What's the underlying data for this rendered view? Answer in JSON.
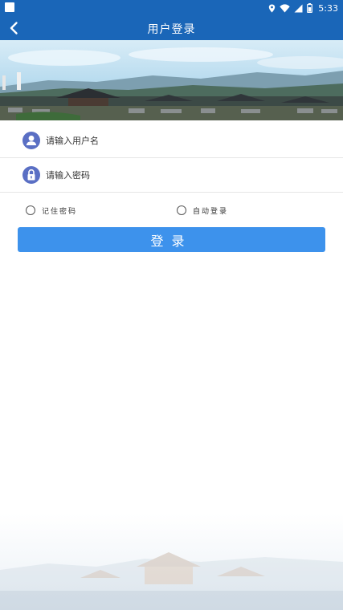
{
  "status_bar": {
    "time": "5:33",
    "icons": [
      "location-icon",
      "wifi-icon",
      "signal-icon",
      "battery-icon"
    ]
  },
  "app_bar": {
    "title": "用户登录",
    "back_icon": "chevron-left-icon"
  },
  "form": {
    "username": {
      "placeholder": "请输入用户名",
      "value": "",
      "icon": "user-icon"
    },
    "password": {
      "placeholder": "请输入密码",
      "value": "",
      "icon": "lock-icon"
    }
  },
  "options": {
    "remember_password": {
      "label": "记住密码",
      "checked": false
    },
    "auto_login": {
      "label": "自动登录",
      "checked": false
    }
  },
  "login_button": {
    "label": "登录"
  },
  "colors": {
    "primary": "#1a66b8",
    "button": "#3d92ec",
    "icon_circle": "#5a6fc4"
  }
}
